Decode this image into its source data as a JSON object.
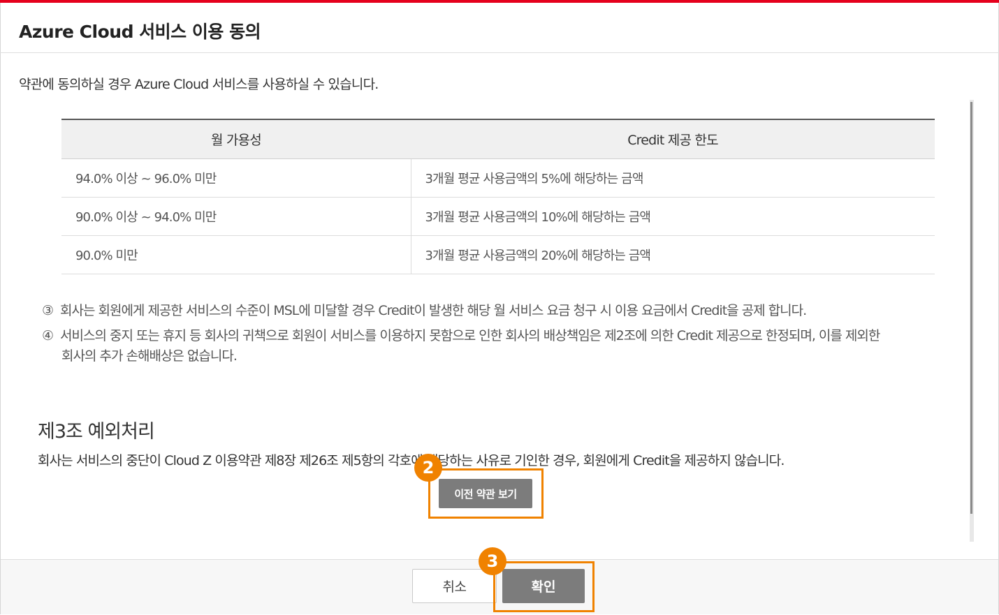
{
  "dialog": {
    "title": "Azure Cloud 서비스 이용 동의",
    "intro": "약관에 동의하실 경우 Azure Cloud 서비스를 사용하실 수 있습니다."
  },
  "sla_table": {
    "headers": [
      "월 가용성",
      "Credit 제공 한도"
    ],
    "rows": [
      [
        "94.0% 이상 ~ 96.0% 미만",
        "3개월 평균 사용금액의 5%에 해당하는 금액"
      ],
      [
        "90.0% 이상 ~ 94.0% 미만",
        "3개월 평균 사용금액의 10%에 해당하는 금액"
      ],
      [
        "90.0% 미만",
        "3개월 평균 사용금액의 20%에 해당하는 금액"
      ]
    ]
  },
  "notes": [
    {
      "num": "③",
      "text": "회사는 회원에게 제공한 서비스의 수준이 MSL에 미달할 경우 Credit이 발생한 해당 월 서비스 요금 청구 시 이용 요금에서 Credit을 공제 합니다."
    },
    {
      "num": "④",
      "text": "서비스의 중지 또는 휴지 등 회사의 귀책으로 회원이 서비스를 이용하지 못함으로 인한 회사의 배상책임은 제2조에 의한 Credit 제공으로 한정되며, 이를 제외한",
      "cont": "회사의 추가 손해배상은 없습니다."
    }
  ],
  "section3": {
    "title": "제3조 예외처리",
    "body": "회사는 서비스의 중단이 Cloud Z 이용약관 제8장 제26조 제5항의 각호에 해당하는 사유로 기인한 경우, 회원에게 Credit을 제공하지 않습니다."
  },
  "buttons": {
    "prev_terms": "이전 약관 보기",
    "cancel": "취소",
    "confirm": "확인"
  },
  "annotations": {
    "badge_2": "2",
    "badge_3": "3",
    "highlight_color": "#f08200"
  },
  "colors": {
    "accent_bar": "#e5001c",
    "button_gray": "#7c7c7c"
  }
}
